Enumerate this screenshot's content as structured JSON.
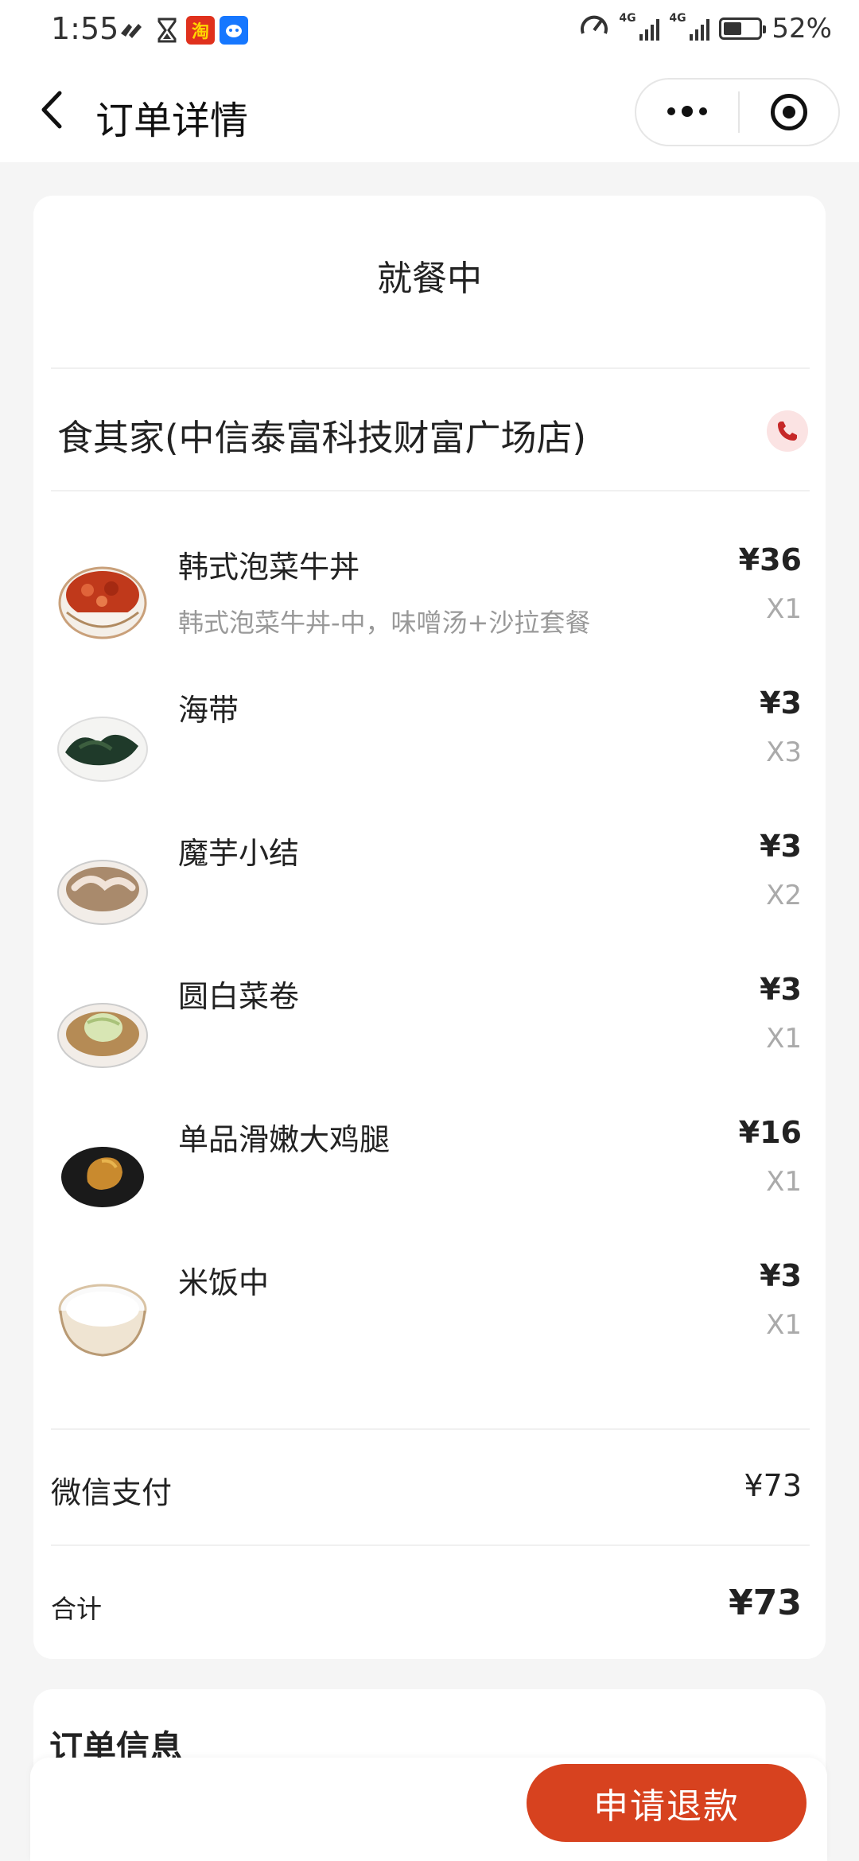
{
  "status_bar": {
    "time": "1:55",
    "icons": [
      "signal-tick-icon",
      "hourglass-icon",
      "taobao-app-icon",
      "assistant-app-icon"
    ],
    "taobao_label": "淘",
    "network_tag_1": "4G",
    "network_tag_2": "4G",
    "battery_percent": 52,
    "battery_text": "52%"
  },
  "nav": {
    "title": "订单详情"
  },
  "order": {
    "status": "就餐中",
    "store_name": "食其家(中信泰富科技财富广场店)",
    "items": [
      {
        "name": "韩式泡菜牛丼",
        "desc": "韩式泡菜牛丼-中，味噌汤+沙拉套餐",
        "price": "¥36",
        "qty": "X1",
        "icon": "kimchi-beef-bowl"
      },
      {
        "name": "海带",
        "desc": "",
        "price": "¥3",
        "qty": "X3",
        "icon": "seaweed-dish"
      },
      {
        "name": "魔芋小结",
        "desc": "",
        "price": "¥3",
        "qty": "X2",
        "icon": "konjac-knot-soup"
      },
      {
        "name": "圆白菜卷",
        "desc": "",
        "price": "¥3",
        "qty": "X1",
        "icon": "cabbage-roll-soup"
      },
      {
        "name": "单品滑嫩大鸡腿",
        "desc": "",
        "price": "¥16",
        "qty": "X1",
        "icon": "chicken-leg-plate"
      },
      {
        "name": "米饭中",
        "desc": "",
        "price": "¥3",
        "qty": "X1",
        "icon": "rice-bowl"
      }
    ],
    "payment_method": "微信支付",
    "payment_amount": "¥73",
    "total_label": "合计",
    "total_amount": "¥73"
  },
  "order_info": {
    "title": "订单信息"
  },
  "actions": {
    "refund_label": "申请退款"
  },
  "colors": {
    "accent": "#d7421f",
    "phone_bg": "#fbe3e3",
    "phone_icon": "#c62828",
    "background": "#f5f5f5"
  }
}
